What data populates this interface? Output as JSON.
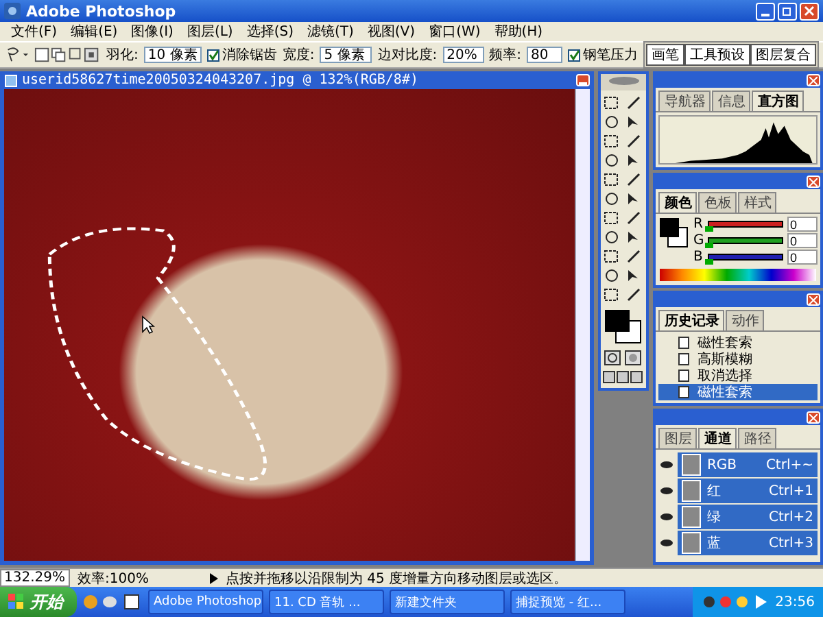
{
  "window": {
    "title": "Adobe Photoshop"
  },
  "menu": [
    "文件(F)",
    "编辑(E)",
    "图像(I)",
    "图层(L)",
    "选择(S)",
    "滤镜(T)",
    "视图(V)",
    "窗口(W)",
    "帮助(H)"
  ],
  "options_bar": {
    "feather_label": "羽化:",
    "feather_value": "10 像素",
    "antialias": {
      "label": "消除锯齿",
      "checked": true
    },
    "width_label": "宽度:",
    "width_value": "5 像素",
    "contrast_label": "边对比度:",
    "contrast_value": "20%",
    "frequency_label": "频率:",
    "frequency_value": "80",
    "pen_pressure": {
      "label": "钢笔压力",
      "checked": true
    },
    "palette_tabs": [
      "画笔",
      "工具预设",
      "图层复合"
    ]
  },
  "document": {
    "title": "userid58627time20050324043207.jpg @ 132%(RGB/8#)"
  },
  "navigator_panel": {
    "tabs": [
      {
        "label": "导航器",
        "selected": false
      },
      {
        "label": "信息",
        "selected": false
      },
      {
        "label": "直方图",
        "selected": true
      }
    ]
  },
  "color_panel": {
    "tabs": [
      {
        "label": "颜色",
        "selected": true
      },
      {
        "label": "色板",
        "selected": false
      },
      {
        "label": "样式",
        "selected": false
      }
    ],
    "channels": [
      {
        "name": "R",
        "level": 0,
        "reading": "0",
        "color": "#cc2020"
      },
      {
        "name": "G",
        "level": 0,
        "reading": "0",
        "color": "#20a020"
      },
      {
        "name": "B",
        "level": 0,
        "reading": "0",
        "color": "#2020b0"
      }
    ]
  },
  "history_panel": {
    "tabs": [
      {
        "label": "历史记录",
        "selected": true
      },
      {
        "label": "动作",
        "selected": false
      }
    ],
    "items": [
      {
        "label": "磁性套索",
        "selected": false
      },
      {
        "label": "高斯模糊",
        "selected": false
      },
      {
        "label": "取消选择",
        "selected": false
      },
      {
        "label": "磁性套索",
        "selected": true
      }
    ]
  },
  "layers_panel": {
    "tabs": [
      {
        "label": "图层",
        "selected": false
      },
      {
        "label": "通道",
        "selected": true
      },
      {
        "label": "路径",
        "selected": false
      }
    ],
    "channels": [
      {
        "name": "RGB",
        "shortcut": "Ctrl+~",
        "visible": true,
        "selected": true
      },
      {
        "name": "红",
        "shortcut": "Ctrl+1",
        "visible": true,
        "selected": true
      },
      {
        "name": "绿",
        "shortcut": "Ctrl+2",
        "visible": true,
        "selected": true
      },
      {
        "name": "蓝",
        "shortcut": "Ctrl+3",
        "visible": true,
        "selected": true
      }
    ]
  },
  "status_bar": {
    "zoom": "132.29%",
    "efficiency": "效率:100%",
    "hint": "点按并拖移以沿限制为 45 度增量方向移动图层或选区。"
  },
  "taskbar": {
    "start": "开始",
    "tasks": [
      "Adobe Photoshop",
      "11. CD 音轨 ...",
      "新建文件夹",
      "捕捉预览 - 红..."
    ],
    "time": "23:56"
  }
}
